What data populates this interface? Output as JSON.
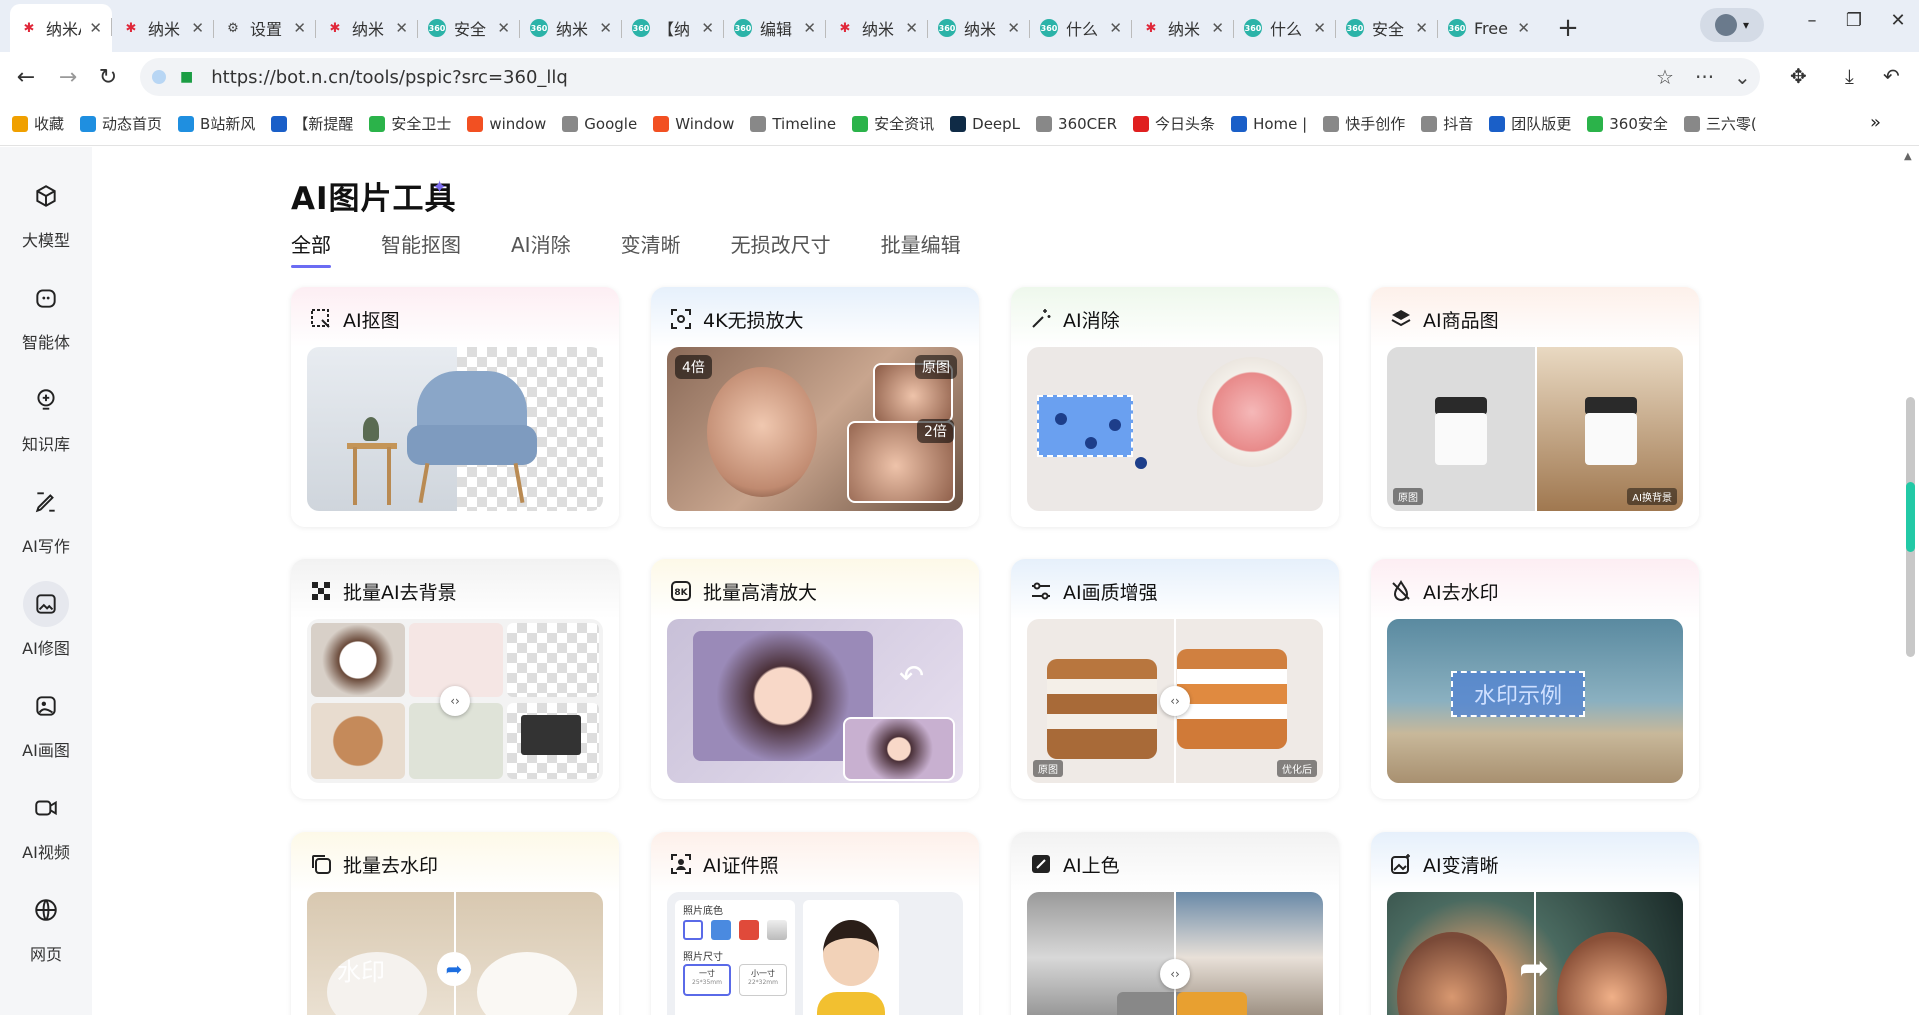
{
  "browser": {
    "tabs": [
      {
        "title": "纳米A",
        "icon": "nami"
      },
      {
        "title": "纳米",
        "icon": "nami"
      },
      {
        "title": "设置",
        "icon": "gear"
      },
      {
        "title": "纳米",
        "icon": "nami"
      },
      {
        "title": "安全",
        "icon": "360"
      },
      {
        "title": "纳米",
        "icon": "360"
      },
      {
        "title": "【纳",
        "icon": "360"
      },
      {
        "title": "编辑",
        "icon": "360"
      },
      {
        "title": "纳米",
        "icon": "nami"
      },
      {
        "title": "纳米",
        "icon": "360"
      },
      {
        "title": "什么",
        "icon": "360"
      },
      {
        "title": "纳米",
        "icon": "nami"
      },
      {
        "title": "什么",
        "icon": "360"
      },
      {
        "title": "安全",
        "icon": "360"
      },
      {
        "title": "Free",
        "icon": "360"
      }
    ],
    "new_tab": "+",
    "url": "https://bot.n.cn/tools/pspic?src=360_llq",
    "bookmarks": [
      {
        "label": "收藏",
        "color": "#f0a000"
      },
      {
        "label": "动态首页",
        "color": "#1f8fe0"
      },
      {
        "label": "B站新风",
        "color": "#1f8fe0"
      },
      {
        "label": "【新提醒",
        "color": "#1a5fc8"
      },
      {
        "label": "安全卫士",
        "color": "#2bb34a"
      },
      {
        "label": "window",
        "color": "#f25022"
      },
      {
        "label": "Google",
        "color": "#888888"
      },
      {
        "label": "Window",
        "color": "#f25022"
      },
      {
        "label": "Timeline",
        "color": "#888888"
      },
      {
        "label": "安全资讯",
        "color": "#2bb34a"
      },
      {
        "label": "DeepL",
        "color": "#0f2b46"
      },
      {
        "label": "360CER",
        "color": "#888888"
      },
      {
        "label": "今日头条",
        "color": "#e02020"
      },
      {
        "label": "Home |",
        "color": "#1a5fc8"
      },
      {
        "label": "快手创作",
        "color": "#888888"
      },
      {
        "label": "抖音",
        "color": "#888888"
      },
      {
        "label": "团队版更",
        "color": "#1a5fc8"
      },
      {
        "label": "360安全",
        "color": "#2bb34a"
      },
      {
        "label": "三六零(",
        "color": "#888888"
      }
    ],
    "more": "»"
  },
  "sidebar": [
    {
      "label": "大模型",
      "icon": "cube-icon"
    },
    {
      "label": "智能体",
      "icon": "agent-icon"
    },
    {
      "label": "知识库",
      "icon": "knowledge-icon"
    },
    {
      "label": "AI写作",
      "icon": "pen-icon"
    },
    {
      "label": "AI修图",
      "icon": "image-edit-icon",
      "active": true
    },
    {
      "label": "AI画图",
      "icon": "paint-icon"
    },
    {
      "label": "AI视频",
      "icon": "video-icon"
    },
    {
      "label": "网页",
      "icon": "globe-icon"
    }
  ],
  "page": {
    "title": "AI图片工具",
    "tabs": [
      "全部",
      "智能抠图",
      "AI消除",
      "变清晰",
      "无损改尺寸",
      "批量编辑"
    ]
  },
  "cards": [
    {
      "title": "AI抠图"
    },
    {
      "title": "4K无损放大",
      "labels": [
        "4倍",
        "原图",
        "2倍"
      ]
    },
    {
      "title": "AI消除"
    },
    {
      "title": "AI商品图",
      "labels": [
        "原图",
        "AI换背景"
      ]
    },
    {
      "title": "批量AI去背景"
    },
    {
      "title": "批量高清放大"
    },
    {
      "title": "AI画质增强",
      "labels": [
        "原图",
        "优化后"
      ]
    },
    {
      "title": "AI去水印",
      "labels": [
        "水印示例"
      ]
    },
    {
      "title": "批量去水印",
      "labels": [
        "水印"
      ]
    },
    {
      "title": "AI证件照",
      "labels": [
        "照片底色",
        "照片尺寸",
        "一寸",
        "25*35mm",
        "小一寸",
        "22*32mm"
      ]
    },
    {
      "title": "AI上色"
    },
    {
      "title": "AI变清晰"
    }
  ]
}
